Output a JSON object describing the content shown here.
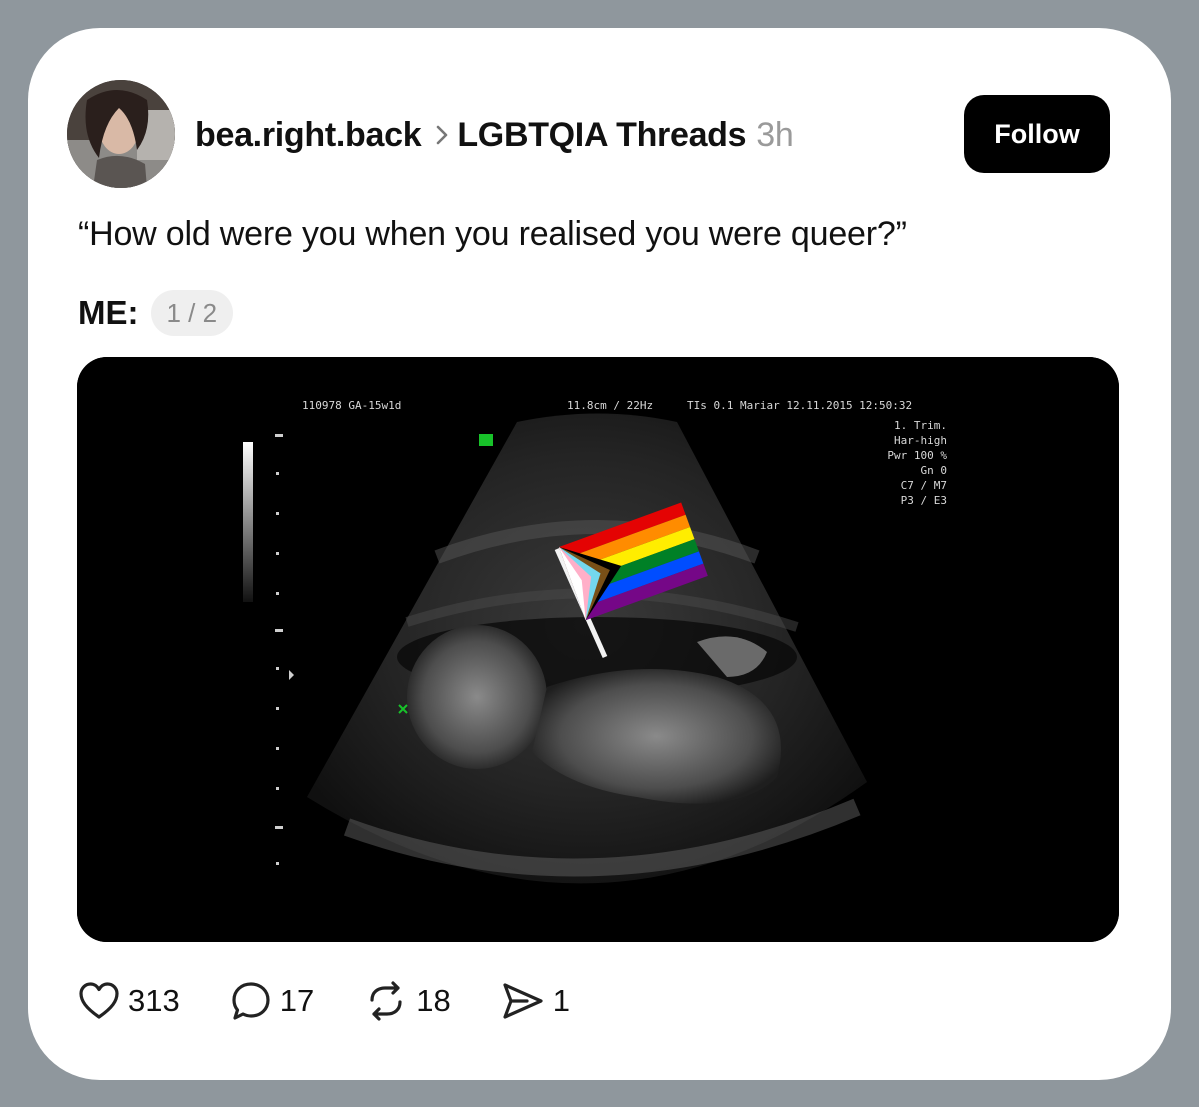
{
  "post": {
    "username": "bea.right.back",
    "community": "LGBTQIA Threads",
    "time": "3h",
    "follow_label": "Follow",
    "text": "“How old were you when you realised you were queer?”",
    "me_label": "ME:",
    "pager": "1 / 2",
    "actions": {
      "likes": "313",
      "comments": "17",
      "reposts": "18",
      "shares": "1"
    }
  },
  "ultrasound": {
    "id_text": "110978 GA-15w1d",
    "scale_text": "11.8cm / 22Hz",
    "info_text": "TIs 0.1  Mariar  12.11.2015  12:50:32",
    "params": [
      "1. Trim.",
      "Har-high",
      "Pwr 100 %",
      "Gn   0",
      "C7 / M7",
      "P3 / E3"
    ]
  },
  "colors": {
    "follow_bg": "#000000",
    "time_gray": "#9a9a9a",
    "frame_gray": "#8f979d"
  }
}
